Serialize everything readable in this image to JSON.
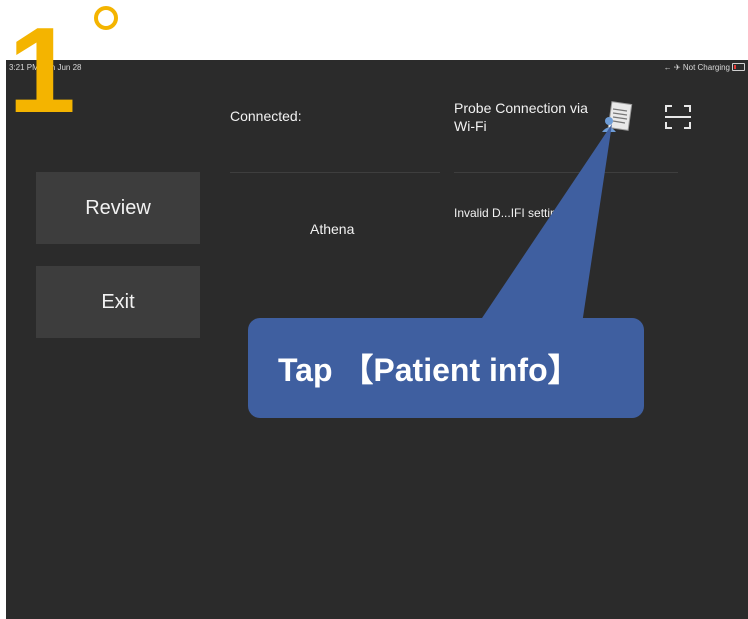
{
  "step": {
    "number": "1"
  },
  "statusbar": {
    "time_date": "3:21 PM  Sun Jun 28",
    "right_status": "← ✈ Not Charging"
  },
  "sidebar": {
    "review_label": "Review",
    "exit_label": "Exit"
  },
  "connection": {
    "connected_label": "Connected:",
    "probe_label_line1": "Probe Connection via",
    "probe_label_line2": "Wi-Fi",
    "device_name": "Athena",
    "wifi_status": "Invalid D...IFI setting"
  },
  "tooltip": {
    "text": "Tap 【Patient info】"
  },
  "colors": {
    "accent": "#f4b400",
    "tooltip_bg": "#3f5fa0",
    "screen_bg": "#2b2b2b",
    "button_bg": "#3d3d3d"
  },
  "icons": {
    "patient_info": "patient-info-icon",
    "scan": "scan-icon"
  }
}
